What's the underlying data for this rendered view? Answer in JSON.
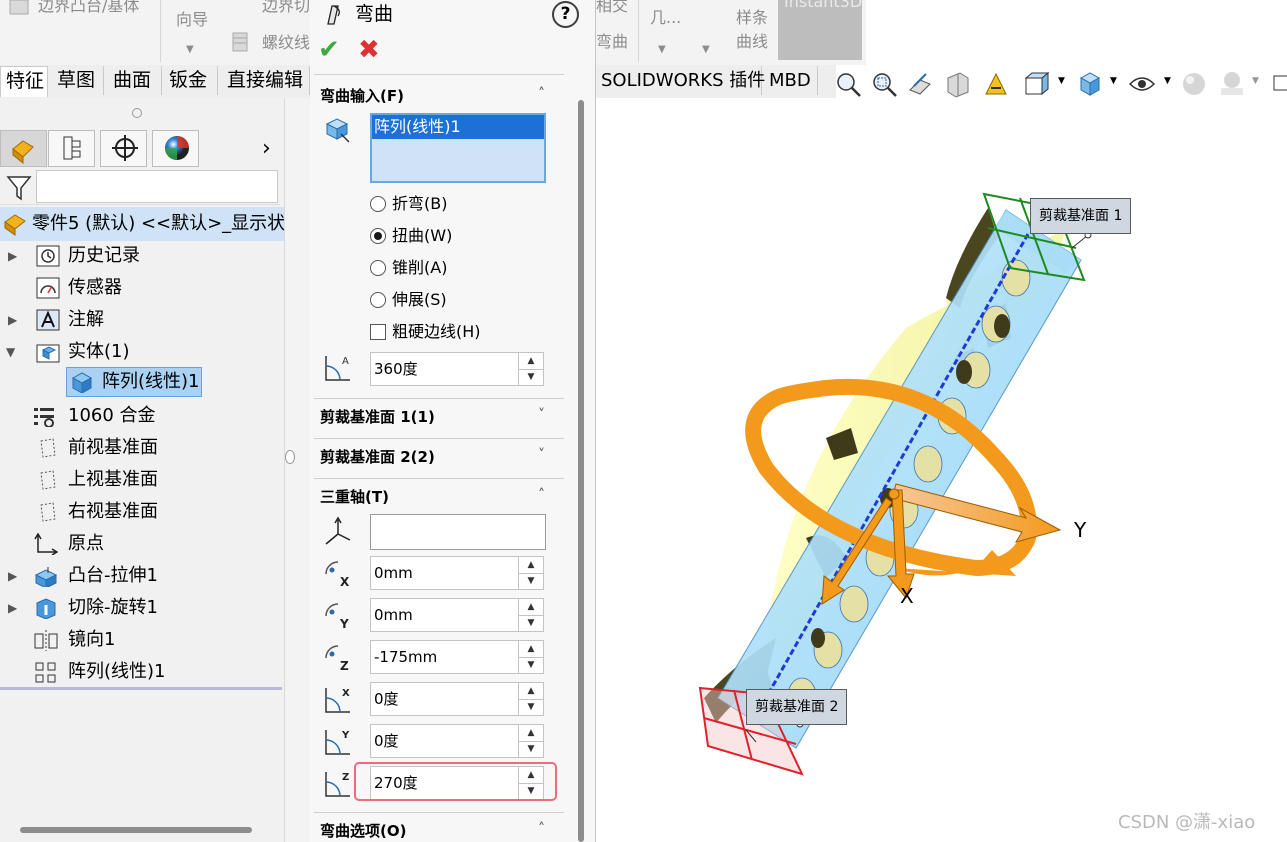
{
  "ribbon": {
    "left_items": [
      "边界凸台/基体",
      "向导",
      "边界切",
      "螺纹线"
    ],
    "right_items": [
      "相交",
      "弯曲",
      "几...",
      "样条",
      "曲线"
    ],
    "instant3d": "Instant3D"
  },
  "tabs": {
    "left": [
      "特征",
      "草图",
      "曲面",
      "钣金",
      "直接编辑"
    ],
    "right": [
      "SOLIDWORKS 插件",
      "MBD"
    ]
  },
  "feature_tree": {
    "root": "零件5 (默认) <<默认>_显示状态",
    "items": [
      {
        "label": "历史记录"
      },
      {
        "label": "传感器"
      },
      {
        "label": "注解"
      },
      {
        "label": "实体(1)"
      },
      {
        "label": "阵列(线性)1"
      },
      {
        "label": "1060 合金"
      },
      {
        "label": "前视基准面"
      },
      {
        "label": "上视基准面"
      },
      {
        "label": "右视基准面"
      },
      {
        "label": "原点"
      },
      {
        "label": "凸台-拉伸1"
      },
      {
        "label": "切除-旋转1"
      },
      {
        "label": "镜向1"
      },
      {
        "label": "阵列(线性)1"
      }
    ]
  },
  "property_manager": {
    "title": "弯曲",
    "help": "?",
    "ok": "✔",
    "cancel": "✖",
    "sections": {
      "bend_input": "弯曲输入(F)",
      "trim_plane_1": "剪裁基准面 1(1)",
      "trim_plane_2": "剪裁基准面 2(2)",
      "triad": "三重轴(T)",
      "bend_options": "弯曲选项(O)"
    },
    "selected_body": "阵列(线性)1",
    "options": {
      "flex": "折弯(B)",
      "twist": "扭曲(W)",
      "taper": "锥削(A)",
      "stretch": "伸展(S)",
      "hard_edges": "粗硬边线(H)"
    },
    "angle": "360度",
    "triad_input": "",
    "triad_x": "0mm",
    "triad_y": "0mm",
    "triad_z": "-175mm",
    "rot_x": "0度",
    "rot_y": "0度",
    "rot_z": "270度"
  },
  "graphics": {
    "callout_1": "剪裁基准面 1",
    "callout_2": "剪裁基准面 2",
    "axis_y": "Y",
    "axis_x": "X"
  },
  "watermark": "CSDN @潇-xiao"
}
